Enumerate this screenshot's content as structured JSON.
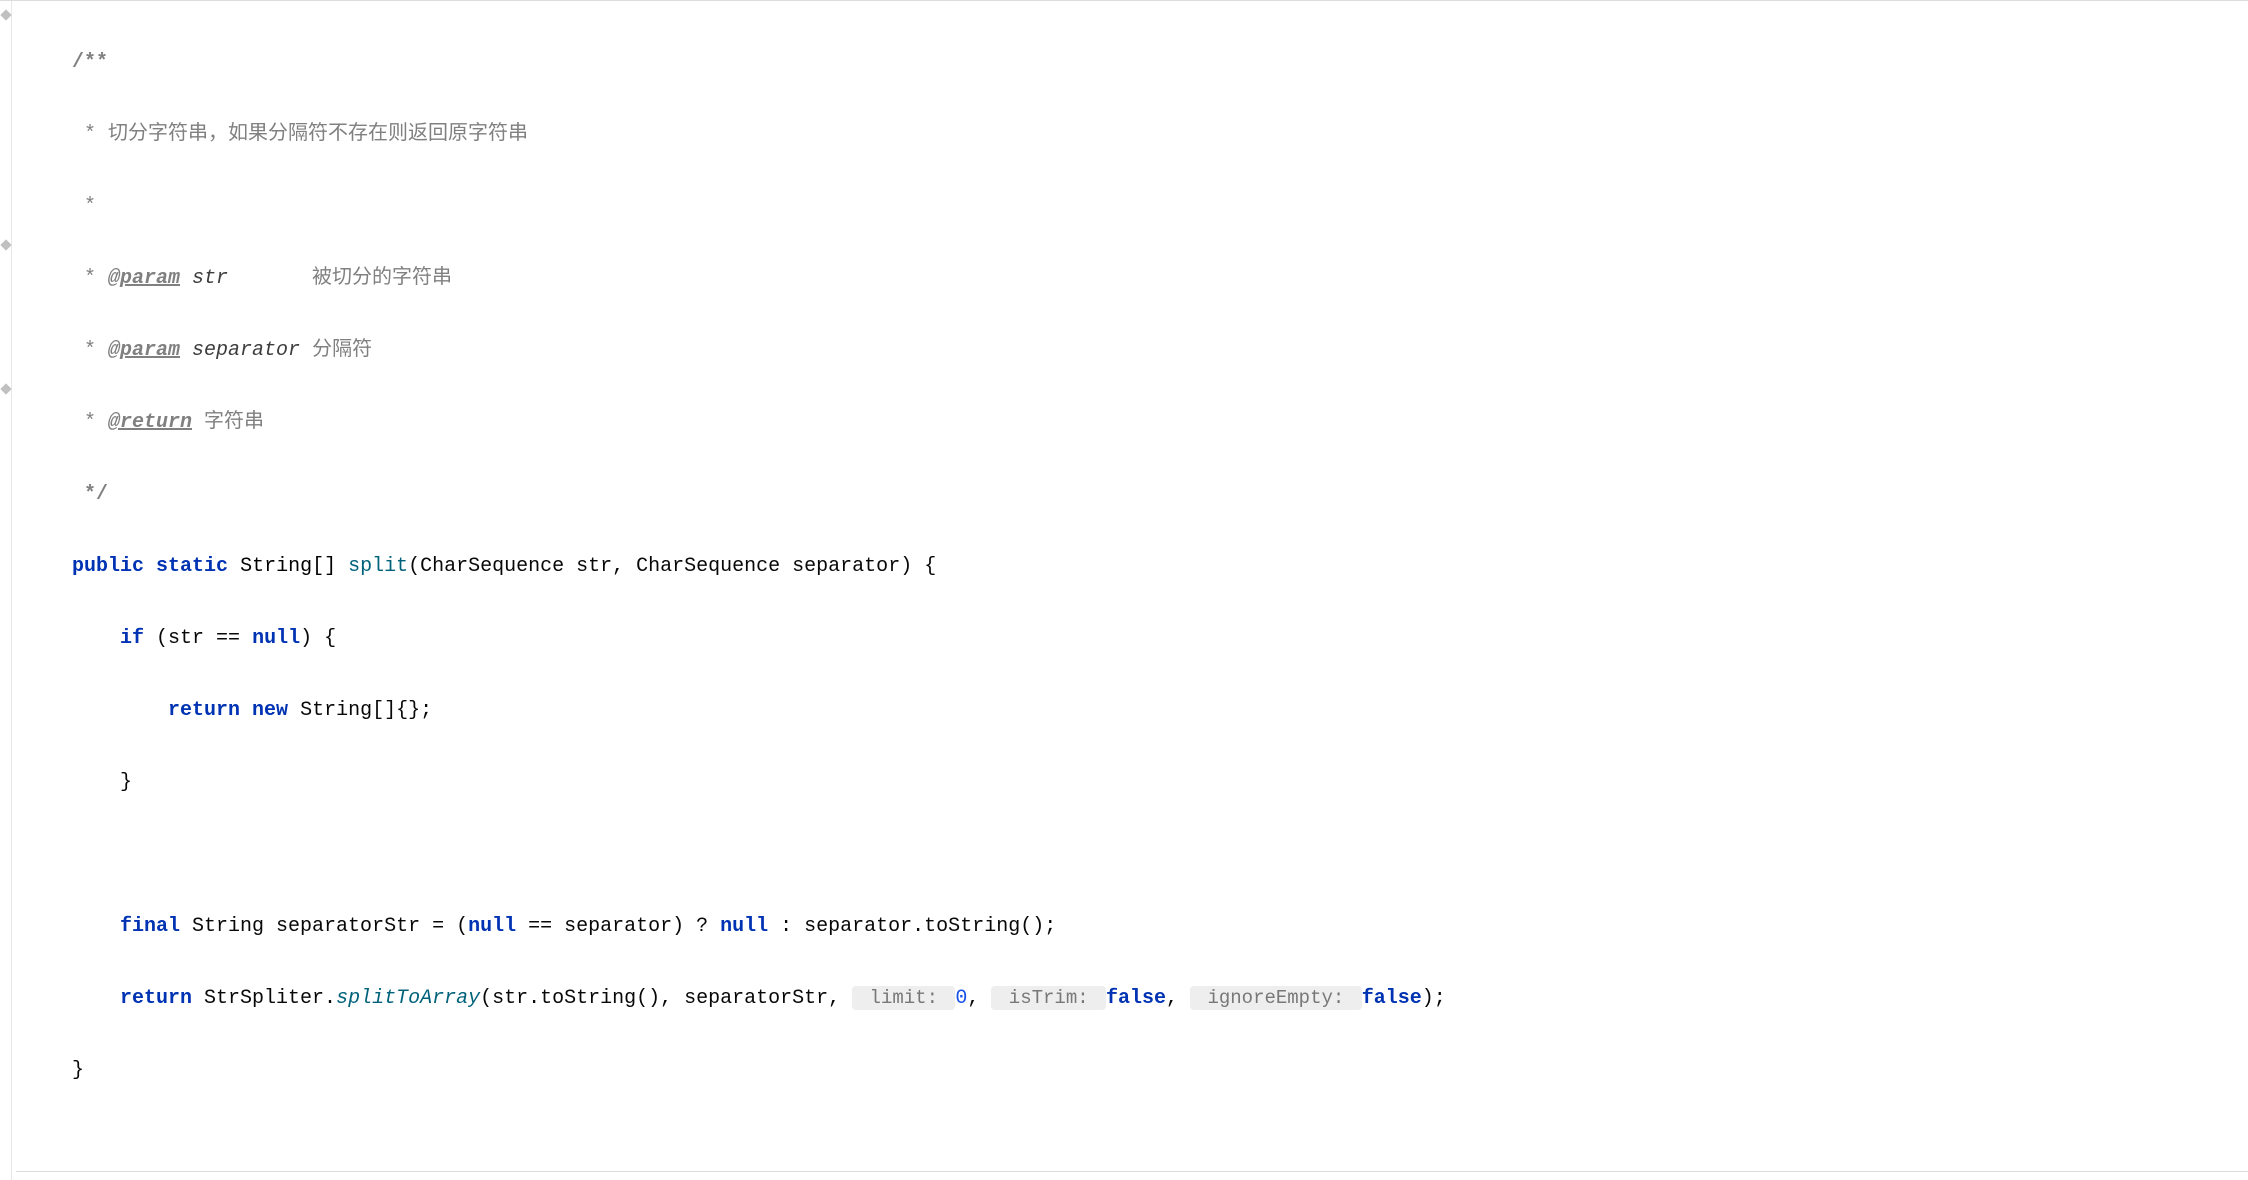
{
  "code": {
    "l1": "/**",
    "l2_prefix": " * ",
    "l2_text": "切分字符串，如果分隔符不存在则返回原字符串",
    "l3": " *",
    "l4_prefix": " * ",
    "l4_tag": "@param",
    "l4_name": " str",
    "l4_desc": "       被切分的字符串",
    "l5_prefix": " * ",
    "l5_tag": "@param",
    "l5_name": " separator",
    "l5_desc": " 分隔符",
    "l6_prefix": " * ",
    "l6_tag": "@return",
    "l6_desc": " 字符串",
    "l7": " */",
    "l8_public": "public",
    "l8_static": "static",
    "l8_type": "String[]",
    "l8_method": "split",
    "l8_params": "(CharSequence str, CharSequence separator) {",
    "l9_if": "if",
    "l9_cond_open": " (str == ",
    "l9_null": "null",
    "l9_cond_close": ") {",
    "l10_return": "return",
    "l10_new": "new",
    "l10_rest": " String[]{};",
    "l11": "    }",
    "l13_final": "final",
    "l13_type": " String separatorStr = (",
    "l13_null1": "null",
    "l13_eq": " == separator) ? ",
    "l13_null2": "null",
    "l13_rest": " : separator.toString();",
    "l14_return": "return",
    "l14_call1": " StrSpliter.",
    "l14_method": "splitToArray",
    "l14_call2": "(str.toString(), separatorStr, ",
    "l14_hint1": " limit: ",
    "l14_val1": "0",
    "l14_sep1": ", ",
    "l14_hint2": " isTrim: ",
    "l14_val2": "false",
    "l14_sep2": ", ",
    "l14_hint3": " ignoreEmpty: ",
    "l14_val3": "false",
    "l14_end": ");",
    "l15": "}"
  },
  "watermark": ""
}
